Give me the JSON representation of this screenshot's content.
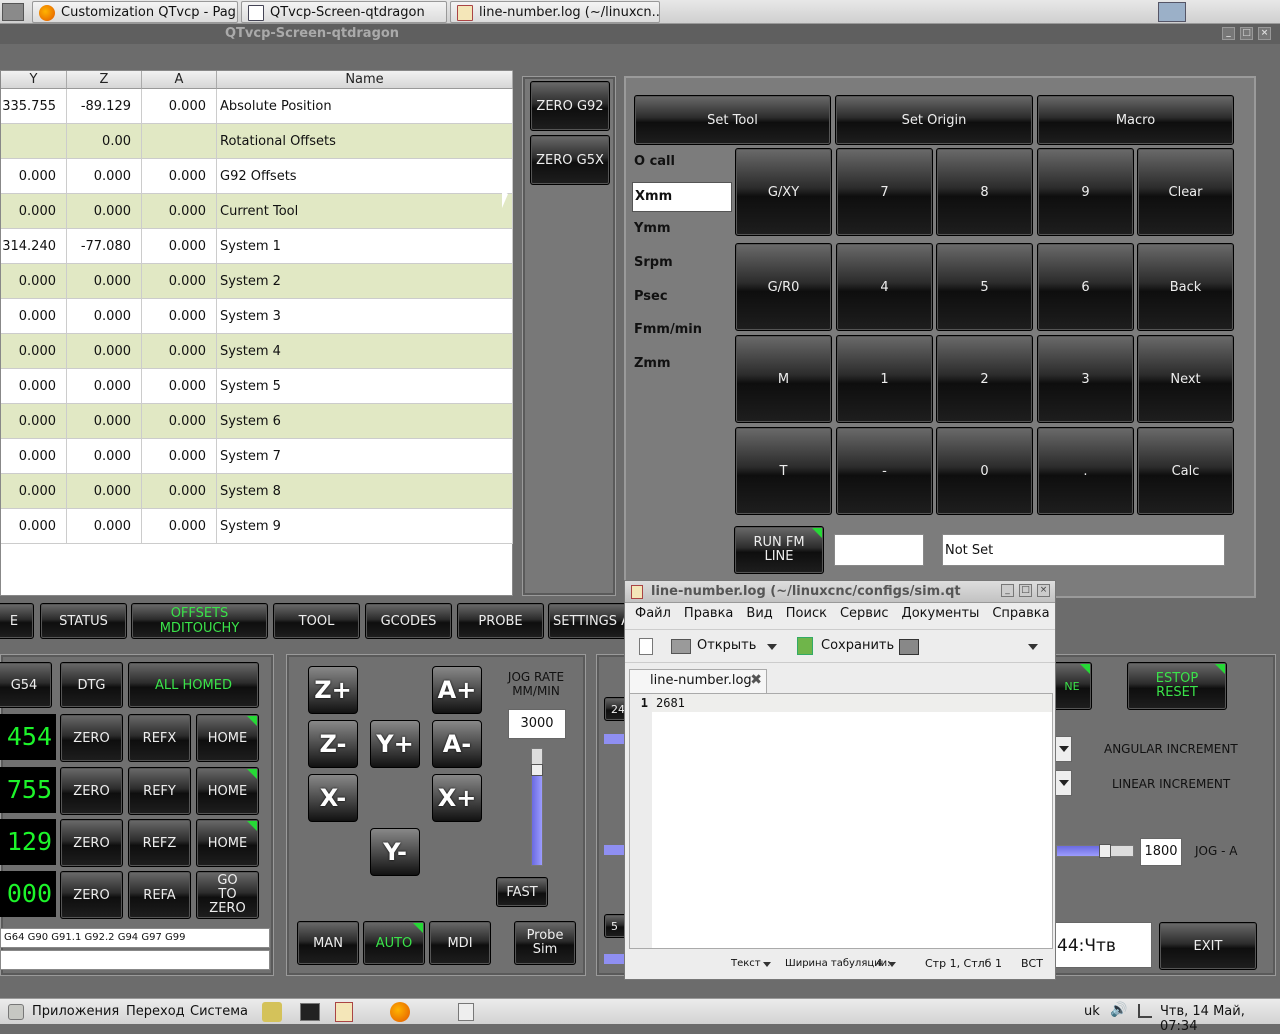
{
  "browser_tabs": [
    {
      "label": "Customization QTvcp - Pag..."
    },
    {
      "label": "QTvcp-Screen-qtdragon"
    },
    {
      "label": "line-number.log (~/linuxcn..."
    }
  ],
  "window_title": "QTvcp-Screen-qtdragon",
  "offsets_table": {
    "columns": [
      "Y",
      "Z",
      "A",
      "Name"
    ],
    "rows": [
      {
        "y": "335.755",
        "z": "-89.129",
        "a": "0.000",
        "name": "Absolute Position"
      },
      {
        "y": "",
        "z": "0.00",
        "a": "",
        "name": "Rotational Offsets"
      },
      {
        "y": "0.000",
        "z": "0.000",
        "a": "0.000",
        "name": "G92 Offsets"
      },
      {
        "y": "0.000",
        "z": "0.000",
        "a": "0.000",
        "name": "Current Tool"
      },
      {
        "y": "314.240",
        "z": "-77.080",
        "a": "0.000",
        "name": "System 1"
      },
      {
        "y": "0.000",
        "z": "0.000",
        "a": "0.000",
        "name": "System 2"
      },
      {
        "y": "0.000",
        "z": "0.000",
        "a": "0.000",
        "name": "System 3"
      },
      {
        "y": "0.000",
        "z": "0.000",
        "a": "0.000",
        "name": "System 4"
      },
      {
        "y": "0.000",
        "z": "0.000",
        "a": "0.000",
        "name": "System 5"
      },
      {
        "y": "0.000",
        "z": "0.000",
        "a": "0.000",
        "name": "System 6"
      },
      {
        "y": "0.000",
        "z": "0.000",
        "a": "0.000",
        "name": "System 7"
      },
      {
        "y": "0.000",
        "z": "0.000",
        "a": "0.000",
        "name": "System 8"
      },
      {
        "y": "0.000",
        "z": "0.000",
        "a": "0.000",
        "name": "System 9"
      }
    ]
  },
  "zero_buttons": {
    "g92": "ZERO G92",
    "g5x": "ZERO G5X"
  },
  "keypad": {
    "top": [
      "Set Tool",
      "Set Origin",
      "Macro"
    ],
    "labels": [
      "O call",
      "Xmm",
      "Ymm",
      "Srpm",
      "Psec",
      "Fmm/min",
      "Zmm"
    ],
    "keys": [
      [
        "G/XY",
        "7",
        "8",
        "9",
        "Clear"
      ],
      [
        "G/R0",
        "4",
        "5",
        "6",
        "Back"
      ],
      [
        "M",
        "1",
        "2",
        "3",
        "Next"
      ],
      [
        "T",
        "-",
        "0",
        ".",
        "Calc"
      ]
    ],
    "run_label": "RUN FM LINE",
    "status": "Not Set"
  },
  "tabs": [
    "E",
    "STATUS",
    "OFFSETS MDITOUCHY",
    "TOOL",
    "GCODES",
    "PROBE",
    "SETTINGS A"
  ],
  "dro": {
    "top": [
      "G54",
      "DTG",
      "ALL HOMED"
    ],
    "values": [
      "454",
      "755",
      "129",
      "000"
    ],
    "zero": "ZERO",
    "ref": [
      "REFX",
      "REFY",
      "REFZ",
      "REFA"
    ],
    "home": [
      "HOME",
      "HOME",
      "HOME"
    ],
    "goto": "GO TO ZERO",
    "gcodes": "G64 G90 G91.1 G92.2 G94 G97 G99"
  },
  "jog": {
    "buttons": [
      "Z+",
      "A+",
      "Z-",
      "Y+",
      "A-",
      "X-",
      "X+",
      "Y-"
    ],
    "rate_label": "JOG RATE MM/MIN",
    "rate": "3000",
    "rate_fill_pct": 82,
    "fast": "FAST"
  },
  "modes": [
    "MAN",
    "AUTO",
    "MDI"
  ],
  "probe_sim": "Probe Sim",
  "right": {
    "estop": "ESTOP RESET",
    "partial_on": "NE",
    "angular": "ANGULAR INCREMENT",
    "linear": "LINEAR INCREMENT",
    "jog_a_value": "1800",
    "jog_a_label": "JOG - A",
    "clock": "44:Чтв",
    "exit": "EXIT",
    "partial_left": [
      "24",
      "5"
    ]
  },
  "gedit": {
    "title": "line-number.log (~/linuxcnc/configs/sim.qtdra",
    "menu": [
      "Файл",
      "Правка",
      "Вид",
      "Поиск",
      "Сервис",
      "Документы",
      "Справка"
    ],
    "open": "Открыть",
    "save": "Сохранить",
    "tab": "line-number.log",
    "line_no": "1",
    "content": "2681",
    "status": {
      "lang": "Текст",
      "tab": "Ширина табуляции:",
      "tabw": "4",
      "pos": "Стр 1, Стлб 1",
      "mode": "ВСТ"
    }
  },
  "taskbar": {
    "apps": "Приложения",
    "go": "Переход",
    "system": "Система",
    "kbd": "uk",
    "datetime": "Чтв, 14 Май, 07:34"
  }
}
